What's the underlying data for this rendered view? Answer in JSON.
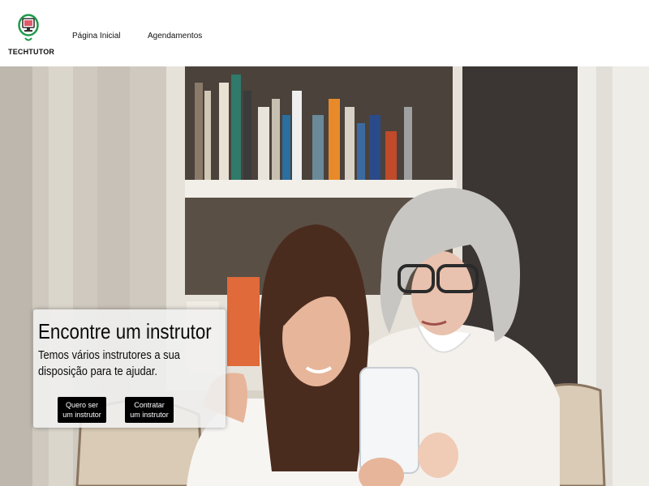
{
  "header": {
    "logo_text": "TECHTUTOR",
    "nav": {
      "home": "Página Inicial",
      "schedules": "Agendamentos"
    }
  },
  "hero": {
    "title": "Encontre um instrutor",
    "text": "Temos vários instrutores a sua disposição para te ajudar.",
    "buttons": {
      "become_instructor": "Quero ser um instrutor",
      "hire_instructor": "Contratar um instrutor"
    }
  },
  "colors": {
    "logo_green": "#1f9a4a",
    "button_bg": "#000000",
    "card_bg": "#f0f0f0"
  }
}
